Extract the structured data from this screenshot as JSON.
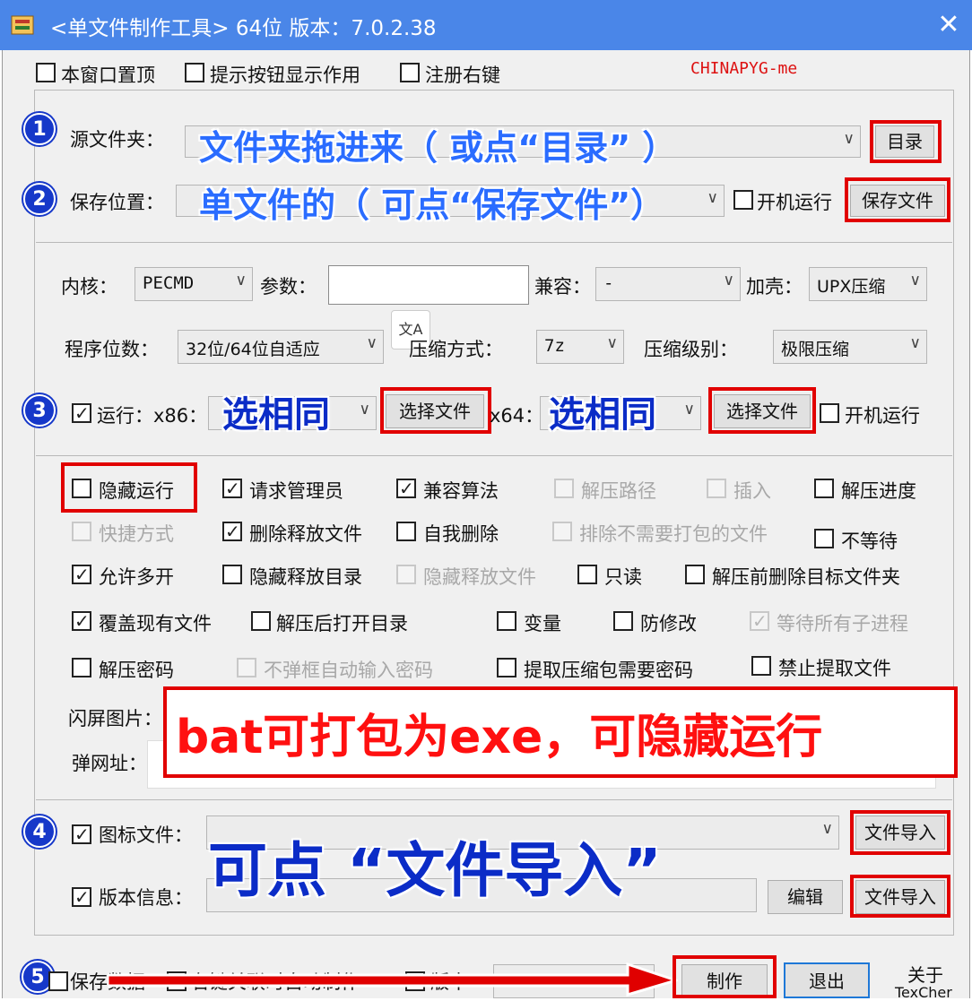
{
  "title": "<单文件制作工具> 64位 版本：7.0.2.38",
  "top_options": [
    {
      "label": "本窗口置顶",
      "checked": false
    },
    {
      "label": "提示按钮显示作用",
      "checked": false
    },
    {
      "label": "注册右键",
      "checked": false
    }
  ],
  "watermark": "CHINAPYG-me",
  "source": {
    "label": "源文件夹：",
    "annotation": "文件夹拖进来（ 或点“目录” ）",
    "button": "目录"
  },
  "save": {
    "label": "保存位置：",
    "annotation": "单文件的（ 可点“保存文件”）",
    "startup_label": "开机运行",
    "button": "保存文件"
  },
  "settings": {
    "kernel_label": "内核：",
    "kernel_value": "PECMD",
    "param_label": "参数：",
    "param_value": "",
    "compat_label": "兼容：",
    "compat_value": "-",
    "shell_label": "加壳：",
    "shell_value": "UPX压缩",
    "bits_label": "程序位数：",
    "bits_value": "32位/64位自适应",
    "compress_label": "压缩方式：",
    "compress_value": "7z",
    "level_label": "压缩级别：",
    "level_value": "极限压缩",
    "translate_glyph": "文A"
  },
  "run": {
    "label": "运行：x86：",
    "checked": true,
    "x86_annotation": "选相同",
    "x86_button": "选择文件",
    "x64_label": "x64：",
    "x64_annotation": "选相同",
    "x64_button": "选择文件",
    "startup_label": "开机运行"
  },
  "options": [
    {
      "label": "隐藏运行",
      "checked": false,
      "disabled": false
    },
    {
      "label": "请求管理员",
      "checked": true,
      "disabled": false
    },
    {
      "label": "兼容算法",
      "checked": true,
      "disabled": false
    },
    {
      "label": "解压路径",
      "checked": false,
      "disabled": true
    },
    {
      "label": "插入",
      "checked": false,
      "disabled": true
    },
    {
      "label": "解压进度",
      "checked": false,
      "disabled": false
    },
    {
      "label": "快捷方式",
      "checked": false,
      "disabled": true
    },
    {
      "label": "删除释放文件",
      "checked": true,
      "disabled": false
    },
    {
      "label": "自我删除",
      "checked": false,
      "disabled": false
    },
    {
      "label": "排除不需要打包的文件",
      "checked": false,
      "disabled": true
    },
    {
      "label": "不等待",
      "checked": false,
      "disabled": false
    },
    {
      "label": "允许多开",
      "checked": true,
      "disabled": false
    },
    {
      "label": "隐藏释放目录",
      "checked": false,
      "disabled": false
    },
    {
      "label": "隐藏释放文件",
      "checked": false,
      "disabled": true
    },
    {
      "label": "只读",
      "checked": false,
      "disabled": false
    },
    {
      "label": "解压前删除目标文件夹",
      "checked": false,
      "disabled": false
    },
    {
      "label": "覆盖现有文件",
      "checked": true,
      "disabled": false
    },
    {
      "label": "解压后打开目录",
      "checked": false,
      "disabled": false
    },
    {
      "label": "变量",
      "checked": false,
      "disabled": false
    },
    {
      "label": "防修改",
      "checked": false,
      "disabled": false
    },
    {
      "label": "等待所有子进程",
      "checked": true,
      "disabled": true
    },
    {
      "label": "解压密码",
      "checked": false,
      "disabled": false
    },
    {
      "label": "不弹框自动输入密码",
      "checked": false,
      "disabled": true
    },
    {
      "label": "提取压缩包需要密码",
      "checked": false,
      "disabled": false
    },
    {
      "label": "禁止提取文件",
      "checked": false,
      "disabled": false
    }
  ],
  "splash_label": "闪屏图片：",
  "popup_label": "弹网址：",
  "bat_annotation": "bat可打包为exe，可隐藏运行",
  "icon_row": {
    "label": "图标文件：",
    "checked": true,
    "button": "文件导入"
  },
  "version_row": {
    "label": "版本信息：",
    "checked": true,
    "edit_button": "编辑",
    "button": "文件导入"
  },
  "import_annotation": "可点 “文件导入”",
  "bottom": {
    "save_data": "保存数据",
    "rightkey_auto": "右键关联时自动制作",
    "partial": "版本",
    "make_button": "制作",
    "exit_button": "退出",
    "about": "关于",
    "about2": "TexCher"
  },
  "step_numbers": [
    "1",
    "2",
    "3",
    "4",
    "5"
  ]
}
